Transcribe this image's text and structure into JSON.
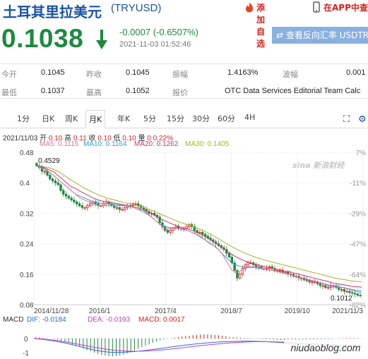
{
  "header": {
    "title": "土耳其里拉美元",
    "code": "(TRYUSD)",
    "add_fav": "添加自选",
    "app_view": "在APP中查看"
  },
  "quote": {
    "price": "0.1038",
    "change": "-0.0007 (-0.6507%)",
    "timestamp": "2021-11-03 01:52:46",
    "reverse_button": "查看反向汇率 USDTRY"
  },
  "stats": {
    "open_label": "今开",
    "open_value": "0.1045",
    "prev_close_label": "昨收",
    "prev_close_value": "0.1045",
    "amplitude_label": "振幅",
    "amplitude_value": "1.4163%",
    "volatility_label": "波幅",
    "volatility_value": "0.001",
    "low_label": "最低",
    "low_value": "0.1037",
    "high_label": "最高",
    "high_value": "0.1052",
    "source_label": "报价",
    "source_value": "OTC Data Services Editorial Team Calc"
  },
  "tabs": [
    "1分",
    "日K",
    "周K",
    "月K",
    "年K",
    "5分",
    "15分",
    "30分",
    "60分",
    "4H"
  ],
  "active_tab": "月K",
  "ohlc": {
    "date": "2021/11/03",
    "open_label": "开",
    "open": "0.10",
    "high_label": "高",
    "high": "0.11",
    "close_label": "收",
    "close": "0.10",
    "low_label": "低",
    "low": "0.10",
    "volume_label": "量",
    "volume": "0",
    "change_pct": "0.22%"
  },
  "ma": {
    "ma5": "MA5: 0.1115",
    "ma10": "MA10: 0.1164",
    "ma20": "MA20: 0.1262",
    "ma30": "MA30: 0.1405"
  },
  "macd": {
    "label": "MACD",
    "dif": "DIF: -0.0184",
    "dea": "DEA: -0.0193",
    "macd": "MACD: 0.0017"
  },
  "watermark": "niudaoblog.com",
  "sina_mark": "sina 新浪财经",
  "colors": {
    "up": "#d6221b",
    "down": "#1d8a3e",
    "ma5": "#e86fa5",
    "ma10": "#2ba3c9",
    "ma20": "#d6336b",
    "ma30": "#9bb82a"
  },
  "chart_data": {
    "type": "candlestick",
    "y_ticks": [
      "0.48",
      "0.4",
      "0.32",
      "0.24",
      "0.16",
      "0.08"
    ],
    "y_tick_values": [
      0.48,
      0.4,
      0.32,
      0.24,
      0.16,
      0.08
    ],
    "right_ticks": [
      "7%",
      "-11%",
      "-29%",
      "-47%",
      "-64%",
      "-82%"
    ],
    "x_labels": [
      "2014/11/28",
      "2016/1",
      "2017/4",
      "2018/7",
      "2019/10",
      "2021/11/3"
    ],
    "ylim": [
      0.08,
      0.48
    ],
    "max_label": "0.4529",
    "min_label": "0.1012",
    "close_series": [
      0.445,
      0.44,
      0.43,
      0.43,
      0.42,
      0.41,
      0.405,
      0.4,
      0.395,
      0.38,
      0.37,
      0.365,
      0.36,
      0.355,
      0.35,
      0.345,
      0.34,
      0.335,
      0.335,
      0.34,
      0.345,
      0.35,
      0.345,
      0.34,
      0.34,
      0.345,
      0.35,
      0.345,
      0.34,
      0.335,
      0.335,
      0.33,
      0.33,
      0.335,
      0.34,
      0.34,
      0.345,
      0.345,
      0.34,
      0.335,
      0.33,
      0.325,
      0.32,
      0.32,
      0.315,
      0.31,
      0.295,
      0.285,
      0.275,
      0.27,
      0.275,
      0.28,
      0.285,
      0.28,
      0.28,
      0.28,
      0.285,
      0.29,
      0.285,
      0.275,
      0.27,
      0.27,
      0.265,
      0.26,
      0.255,
      0.25,
      0.245,
      0.24,
      0.235,
      0.23,
      0.225,
      0.215,
      0.205,
      0.19,
      0.17,
      0.15,
      0.16,
      0.175,
      0.185,
      0.19,
      0.19,
      0.185,
      0.18,
      0.18,
      0.175,
      0.175,
      0.175,
      0.18,
      0.175,
      0.17,
      0.17,
      0.17,
      0.165,
      0.165,
      0.16,
      0.16,
      0.155,
      0.155,
      0.15,
      0.15,
      0.145,
      0.145,
      0.14,
      0.14,
      0.14,
      0.135,
      0.13,
      0.13,
      0.125,
      0.125,
      0.13,
      0.13,
      0.125,
      0.12,
      0.12,
      0.115,
      0.115,
      0.112,
      0.11,
      0.108,
      0.105,
      0.104
    ],
    "ma5": [
      0.445,
      0.44,
      0.435,
      0.43,
      0.42,
      0.41,
      0.4,
      0.39,
      0.38,
      0.37,
      0.36,
      0.355,
      0.35,
      0.345,
      0.34,
      0.34,
      0.34,
      0.34,
      0.34,
      0.34,
      0.34,
      0.34,
      0.335,
      0.33,
      0.33,
      0.32,
      0.31,
      0.3,
      0.29,
      0.28,
      0.28,
      0.28,
      0.28,
      0.28,
      0.275,
      0.27,
      0.265,
      0.26,
      0.25,
      0.24,
      0.235,
      0.225,
      0.21,
      0.19,
      0.17,
      0.165,
      0.17,
      0.18,
      0.18,
      0.18,
      0.178,
      0.175,
      0.172,
      0.17,
      0.168,
      0.165,
      0.162,
      0.16,
      0.156,
      0.152,
      0.148,
      0.145,
      0.142,
      0.14,
      0.136,
      0.132,
      0.128,
      0.127,
      0.126,
      0.124,
      0.121,
      0.117,
      0.114,
      0.111
    ],
    "ma10": [
      0.445,
      0.442,
      0.438,
      0.43,
      0.42,
      0.41,
      0.4,
      0.39,
      0.38,
      0.37,
      0.365,
      0.36,
      0.355,
      0.35,
      0.348,
      0.346,
      0.345,
      0.344,
      0.343,
      0.342,
      0.34,
      0.338,
      0.335,
      0.33,
      0.325,
      0.318,
      0.31,
      0.3,
      0.29,
      0.285,
      0.283,
      0.282,
      0.28,
      0.278,
      0.275,
      0.27,
      0.264,
      0.257,
      0.25,
      0.242,
      0.234,
      0.224,
      0.212,
      0.2,
      0.19,
      0.184,
      0.18,
      0.178,
      0.178,
      0.177,
      0.176,
      0.174,
      0.172,
      0.17,
      0.168,
      0.165,
      0.162,
      0.159,
      0.156,
      0.152,
      0.149,
      0.146,
      0.143,
      0.14,
      0.137,
      0.134,
      0.131,
      0.129,
      0.127,
      0.125,
      0.122,
      0.12,
      0.117,
      0.116
    ],
    "ma20": [
      0.445,
      0.443,
      0.44,
      0.435,
      0.43,
      0.42,
      0.41,
      0.4,
      0.39,
      0.385,
      0.378,
      0.372,
      0.366,
      0.36,
      0.355,
      0.352,
      0.35,
      0.348,
      0.346,
      0.344,
      0.342,
      0.34,
      0.337,
      0.334,
      0.33,
      0.325,
      0.32,
      0.313,
      0.306,
      0.3,
      0.295,
      0.29,
      0.286,
      0.282,
      0.279,
      0.275,
      0.27,
      0.265,
      0.259,
      0.252,
      0.245,
      0.237,
      0.229,
      0.22,
      0.212,
      0.205,
      0.199,
      0.194,
      0.19,
      0.187,
      0.184,
      0.181,
      0.178,
      0.176,
      0.173,
      0.171,
      0.168,
      0.166,
      0.163,
      0.16,
      0.157,
      0.154,
      0.151,
      0.148,
      0.145,
      0.142,
      0.139,
      0.136,
      0.134,
      0.132,
      0.13,
      0.128,
      0.127,
      0.126
    ],
    "ma30": [
      0.445,
      0.444,
      0.442,
      0.44,
      0.436,
      0.43,
      0.423,
      0.415,
      0.407,
      0.4,
      0.393,
      0.386,
      0.38,
      0.374,
      0.369,
      0.364,
      0.36,
      0.357,
      0.354,
      0.351,
      0.348,
      0.345,
      0.342,
      0.339,
      0.336,
      0.332,
      0.328,
      0.323,
      0.318,
      0.313,
      0.308,
      0.303,
      0.298,
      0.294,
      0.29,
      0.286,
      0.282,
      0.277,
      0.272,
      0.266,
      0.26,
      0.253,
      0.246,
      0.239,
      0.232,
      0.226,
      0.22,
      0.215,
      0.21,
      0.206,
      0.202,
      0.198,
      0.195,
      0.192,
      0.189,
      0.186,
      0.183,
      0.18,
      0.177,
      0.174,
      0.171,
      0.168,
      0.165,
      0.162,
      0.159,
      0.156,
      0.153,
      0.15,
      0.148,
      0.146,
      0.144,
      0.142,
      0.141,
      0.14
    ]
  },
  "macd_chart": {
    "y_ticks": [
      "0",
      "-1"
    ],
    "hist": [
      0.05,
      0.04,
      0.03,
      0.02,
      0.0,
      -0.02,
      -0.05,
      -0.08,
      -0.12,
      -0.15,
      -0.2,
      -0.25,
      -0.3,
      -0.35,
      -0.4,
      -0.45,
      -0.5,
      -0.55,
      -0.58,
      -0.6,
      -0.62,
      -0.63,
      -0.62,
      -0.6,
      -0.57,
      -0.53,
      -0.48,
      -0.42,
      -0.36,
      -0.3,
      -0.25,
      -0.2,
      -0.15,
      -0.1,
      -0.06,
      -0.03,
      -0.01,
      0.01,
      0.03,
      0.05,
      0.07,
      0.09,
      0.1,
      0.12,
      0.13,
      0.14,
      0.15,
      0.15,
      0.14,
      0.13,
      0.12,
      0.1,
      0.08,
      0.06,
      0.05,
      0.04,
      0.03,
      0.02,
      0.02,
      0.01,
      0.0,
      -0.01,
      -0.02,
      -0.03,
      -0.03,
      -0.04,
      -0.05,
      -0.05,
      -0.06,
      -0.06,
      -0.07,
      -0.07,
      -0.08,
      -0.08,
      -0.07,
      -0.06,
      -0.05,
      -0.04,
      -0.03,
      -0.02,
      -0.02,
      -0.01,
      0.0,
      0.01,
      0.01,
      0.02,
      0.02,
      0.02,
      0.01,
      0.0
    ],
    "dif": [
      0.0,
      -0.05,
      -0.12,
      -0.2,
      -0.3,
      -0.42,
      -0.55,
      -0.68,
      -0.8,
      -0.9,
      -0.96,
      -0.98,
      -0.97,
      -0.94,
      -0.9,
      -0.84,
      -0.77,
      -0.7,
      -0.62,
      -0.55,
      -0.48,
      -0.42,
      -0.36,
      -0.31,
      -0.27,
      -0.24,
      -0.22,
      -0.2,
      -0.19,
      -0.19,
      -0.2,
      -0.22,
      -0.25,
      -0.28,
      -0.32,
      -0.36,
      -0.4,
      -0.44,
      -0.47,
      -0.5,
      -0.52,
      -0.53,
      -0.53,
      -0.52,
      -0.5
    ],
    "dea": [
      0.0,
      -0.03,
      -0.08,
      -0.14,
      -0.22,
      -0.31,
      -0.41,
      -0.51,
      -0.61,
      -0.7,
      -0.78,
      -0.84,
      -0.88,
      -0.9,
      -0.9,
      -0.88,
      -0.85,
      -0.81,
      -0.76,
      -0.7,
      -0.64,
      -0.58,
      -0.52,
      -0.46,
      -0.41,
      -0.36,
      -0.32,
      -0.28,
      -0.25,
      -0.23,
      -0.22,
      -0.22,
      -0.23,
      -0.25,
      -0.27,
      -0.3,
      -0.33,
      -0.36,
      -0.39,
      -0.42,
      -0.44,
      -0.46,
      -0.48,
      -0.49,
      -0.5
    ]
  }
}
